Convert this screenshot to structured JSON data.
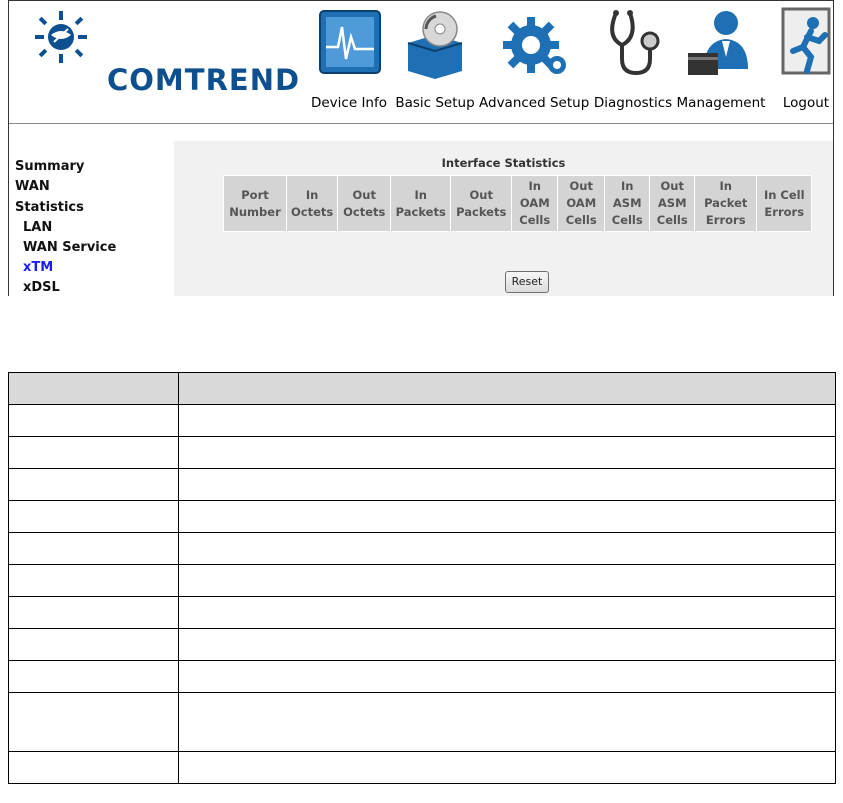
{
  "brand": {
    "name": "COMTREND",
    "color": "#0d4f8f"
  },
  "nav": [
    {
      "label": "Device Info",
      "icon": "device-info-monitor-icon"
    },
    {
      "label": "Basic Setup",
      "icon": "basic-setup-box-disc-icon"
    },
    {
      "label": "Advanced Setup",
      "icon": "advanced-setup-gear-icon"
    },
    {
      "label": "Diagnostics",
      "icon": "diagnostics-stethoscope-icon"
    },
    {
      "label": "Management",
      "icon": "management-person-icon"
    },
    {
      "label": "Logout",
      "icon": "logout-running-man-icon"
    }
  ],
  "sidebar": [
    {
      "label": "Summary",
      "active": false
    },
    {
      "label": "WAN",
      "active": false
    },
    {
      "label": "Statistics",
      "active": false
    },
    {
      "label": "LAN",
      "active": false
    },
    {
      "label": "WAN Service",
      "active": false
    },
    {
      "label": "xTM",
      "active": true
    },
    {
      "label": "xDSL",
      "active": false
    }
  ],
  "stats": {
    "title": "Interface Statistics",
    "columns": [
      [
        "Port",
        "Number"
      ],
      [
        "In",
        "Octets"
      ],
      [
        "Out",
        "Octets"
      ],
      [
        "In",
        "Packets"
      ],
      [
        "Out",
        "Packets"
      ],
      [
        "In",
        "OAM",
        "Cells"
      ],
      [
        "Out",
        "OAM",
        "Cells"
      ],
      [
        "In",
        "ASM",
        "Cells"
      ],
      [
        "Out",
        "ASM",
        "Cells"
      ],
      [
        "In",
        "Packet",
        "Errors"
      ],
      [
        "In Cell",
        "Errors"
      ]
    ],
    "reset_label": "Reset"
  },
  "colors": {
    "active_link": "#1a1aff",
    "header_bg": "#d4d4d4",
    "content_bg": "#f1f1f1"
  },
  "description_table": {
    "row_count": 11,
    "header_shaded": true
  }
}
